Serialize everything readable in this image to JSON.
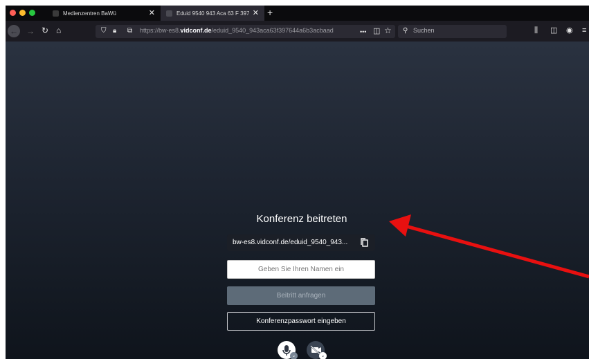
{
  "browser": {
    "tabs": [
      {
        "label": "Medienzentren BaWü",
        "active": false
      },
      {
        "label": "Eduid 9540 943 Aca 63 F 397",
        "active": true
      }
    ],
    "new_tab_label": "+",
    "url_prefix": "https://bw-es8.",
    "url_domain": "vidconf.de",
    "url_path": "/eduid_9540_943aca63f397644a6b3acbaad",
    "search_placeholder": "Suchen",
    "overflow_label": "•••"
  },
  "conference": {
    "title": "Konferenz beitreten",
    "link_text": "bw-es8.vidconf.de/eduid_9540_943...",
    "name_placeholder": "Geben Sie Ihren Namen ein",
    "join_label": "Beitritt anfragen",
    "password_label": "Konferenzpasswort eingeben"
  },
  "colors": {
    "arrow": "#e81010",
    "traffic_red": "#ff5f57",
    "traffic_yellow": "#febc2e",
    "traffic_green": "#28c840"
  }
}
